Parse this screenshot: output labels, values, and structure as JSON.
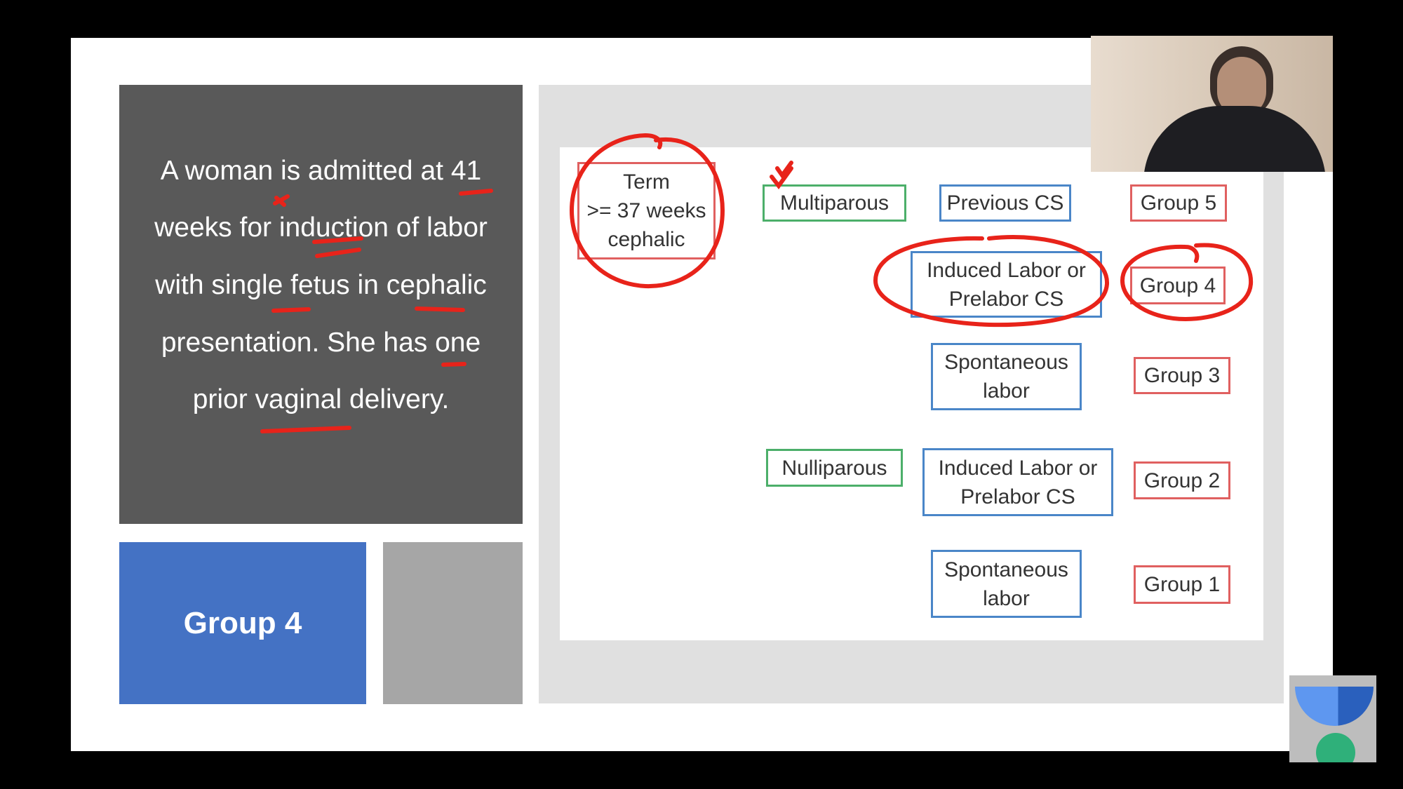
{
  "question": {
    "lines": [
      "A woman is admitted at 41",
      "weeks for induction of labor",
      "with single fetus in cephalic",
      "presentation. She has one",
      "prior vaginal delivery."
    ]
  },
  "answer": {
    "label": "Group 4",
    "color": "#4472c4"
  },
  "diagram": {
    "term": "Term\n>= 37 weeks\ncephalic",
    "multiparous": "Multiparous",
    "nulliparous": "Nulliparous",
    "previous_cs": "Previous CS",
    "induced_multi": "Induced Labor or\nPrelabor CS",
    "spontaneous_multi": "Spontaneous\nlabor",
    "induced_nulli": "Induced Labor or\nPrelabor CS",
    "spontaneous_nulli": "Spontaneous\nlabor",
    "groups": [
      "Group 5",
      "Group 4",
      "Group 3",
      "Group 2",
      "Group 1"
    ]
  },
  "annotation_color": "#e8231a",
  "icons": {
    "logo": "app-logo-icon",
    "webcam": "presenter-video"
  }
}
